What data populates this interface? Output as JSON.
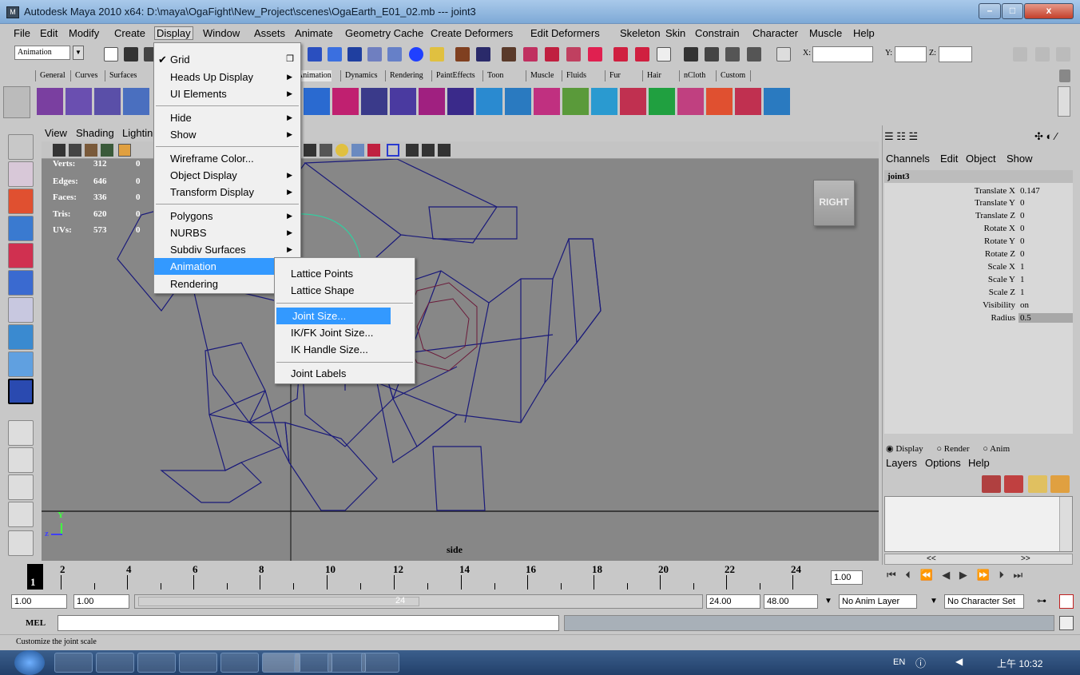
{
  "window": {
    "title": "Autodesk Maya 2010 x64: D:\\maya\\OgaFight\\New_Project\\scenes\\OgaEarth_E01_02.mb  ---  joint3",
    "minimize": "–",
    "maximize": "□",
    "close": "x"
  },
  "menubar": {
    "items": [
      "File",
      "Edit",
      "Modify",
      "Create",
      "Display",
      "Window",
      "Assets",
      "Animate",
      "Geometry Cache",
      "Create Deformers",
      "Edit Deformers",
      "Skeleton",
      "Skin",
      "Constrain",
      "Character",
      "Muscle",
      "Help"
    ],
    "active": "Display"
  },
  "statusline": {
    "mode": "Animation",
    "x_label": "X:",
    "y_label": "Y:",
    "z_label": "Z:"
  },
  "shelf_tabs": [
    "General",
    "Curves",
    "Surfaces",
    "Animation",
    "Dynamics",
    "Rendering",
    "PaintEffects",
    "Toon",
    "Muscle",
    "Fluids",
    "Fur",
    "Hair",
    "nCloth",
    "Custom"
  ],
  "display_menu": {
    "items": [
      {
        "label": "Grid",
        "checked": true,
        "option_box": true
      },
      {
        "label": "Heads Up Display",
        "sub": true
      },
      {
        "label": "UI Elements",
        "sub": true
      },
      {
        "label": "Hide",
        "sub": true
      },
      {
        "label": "Show",
        "sub": true
      },
      {
        "label": "Wireframe Color..."
      },
      {
        "label": "Object Display",
        "sub": true
      },
      {
        "label": "Transform Display",
        "sub": true
      },
      {
        "label": "Polygons",
        "sub": true
      },
      {
        "label": "NURBS",
        "sub": true
      },
      {
        "label": "Subdiv Surfaces",
        "sub": true
      },
      {
        "label": "Animation",
        "sub": true,
        "highlight": true
      },
      {
        "label": "Rendering",
        "sub": true
      }
    ]
  },
  "animation_submenu": {
    "items": [
      {
        "label": "Lattice Points"
      },
      {
        "label": "Lattice Shape"
      },
      {
        "label": "Joint Size...",
        "highlight": true
      },
      {
        "label": "IK/FK Joint Size..."
      },
      {
        "label": "IK Handle Size..."
      },
      {
        "label": "Joint Labels"
      }
    ]
  },
  "viewport": {
    "menu": [
      "View",
      "Shading",
      "Lighting"
    ],
    "hud": [
      {
        "label": "Verts:",
        "value": "312",
        "sel": "0"
      },
      {
        "label": "Edges:",
        "value": "646",
        "sel": "0"
      },
      {
        "label": "Faces:",
        "value": "336",
        "sel": "0"
      },
      {
        "label": "Tris:",
        "value": "620",
        "sel": "0"
      },
      {
        "label": "UVs:",
        "value": "573",
        "sel": "0"
      }
    ],
    "view_cube": "RIGHT",
    "camera_name": "side",
    "axis_z": "z",
    "axis_y": "Y"
  },
  "channel_box": {
    "menu": [
      "Channels",
      "Edit",
      "Object",
      "Show"
    ],
    "node": "joint3",
    "channels": [
      {
        "name": "Translate X",
        "value": "0.147"
      },
      {
        "name": "Translate Y",
        "value": "0"
      },
      {
        "name": "Translate Z",
        "value": "0"
      },
      {
        "name": "Rotate X",
        "value": "0"
      },
      {
        "name": "Rotate Y",
        "value": "0"
      },
      {
        "name": "Rotate Z",
        "value": "0"
      },
      {
        "name": "Scale X",
        "value": "1"
      },
      {
        "name": "Scale Y",
        "value": "1"
      },
      {
        "name": "Scale Z",
        "value": "1"
      },
      {
        "name": "Visibility",
        "value": "on"
      },
      {
        "name": "Radius",
        "value": "0.5"
      }
    ]
  },
  "layer_editor": {
    "radios": [
      "Display",
      "Render",
      "Anim"
    ],
    "selected_radio": "Display",
    "menu": [
      "Layers",
      "Options",
      "Help"
    ],
    "scroll_left": "<<",
    "scroll_right": ">>"
  },
  "timeline": {
    "current_frame": "1",
    "labels": [
      "2",
      "4",
      "6",
      "8",
      "10",
      "12",
      "14",
      "16",
      "18",
      "20",
      "22",
      "24"
    ],
    "current_time_field": "1.00"
  },
  "range_slider": {
    "start": "1.00",
    "playback_start": "1.00",
    "playback_end": "24.00",
    "end": "48.00",
    "slider_end_label": "24",
    "anim_layer": "No Anim Layer",
    "character_set": "No Character Set"
  },
  "command_line": {
    "label": "MEL"
  },
  "help_line": {
    "text": "Customize the joint scale"
  },
  "taskbar": {
    "lang": "EN",
    "clock": "上午 10:32"
  },
  "colors": {
    "menu_highlight": "#3399ff",
    "viewport_bg": "#878787",
    "wireframe": "#1a1a7a",
    "joint": "#6b1a3a"
  }
}
